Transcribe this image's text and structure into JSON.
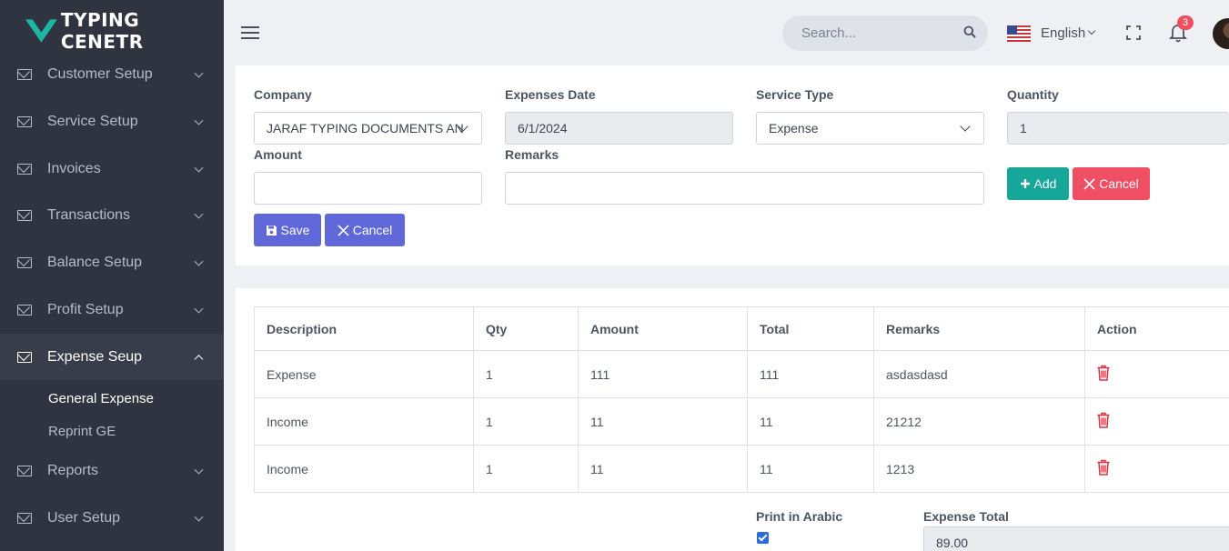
{
  "app": {
    "name": "TYPING CENETR"
  },
  "sidebar": {
    "items": [
      {
        "label": "Customer Setup"
      },
      {
        "label": "Service Setup"
      },
      {
        "label": "Invoices"
      },
      {
        "label": "Transactions"
      },
      {
        "label": "Balance Setup"
      },
      {
        "label": "Profit Setup"
      },
      {
        "label": "Expense Seup"
      },
      {
        "label": "Reports"
      },
      {
        "label": "User Setup"
      }
    ],
    "subitems": [
      {
        "label": "General Expense"
      },
      {
        "label": "Reprint GE"
      }
    ]
  },
  "topbar": {
    "search_placeholder": "Search...",
    "language": "English",
    "notification_count": "3",
    "icons": [
      "hamburger-icon",
      "search-icon",
      "us-flag-icon",
      "fullscreen-icon",
      "bell-icon",
      "avatar"
    ]
  },
  "form": {
    "company_label": "Company",
    "company_value": "JARAF TYPING DOCUMENTS AN",
    "date_label": "Expenses Date",
    "date_value": "6/1/2024",
    "service_type_label": "Service Type",
    "service_type_value": "Expense",
    "quantity_label": "Quantity",
    "quantity_value": "1",
    "amount_label": "Amount",
    "amount_value": "",
    "remarks_label": "Remarks",
    "remarks_value": "",
    "add_label": "Add",
    "cancel_small_label": "Cancel",
    "save_label": "Save",
    "cancel_label": "Cancel"
  },
  "table": {
    "headers": [
      "Description",
      "Qty",
      "Amount",
      "Total",
      "Remarks",
      "Action"
    ],
    "rows": [
      {
        "description": "Expense",
        "qty": "1",
        "amount": "111",
        "total": "111",
        "remarks": "asdasdasd"
      },
      {
        "description": "Income",
        "qty": "1",
        "amount": "11",
        "total": "11",
        "remarks": "21212"
      },
      {
        "description": "Income",
        "qty": "1",
        "amount": "11",
        "total": "11",
        "remarks": "1213"
      }
    ]
  },
  "footer": {
    "print_arabic_label": "Print in Arabic",
    "print_arabic_checked": true,
    "expense_total_label": "Expense Total",
    "expense_total_value": "89.00"
  },
  "colors": {
    "sidebar_bg": "#2f3440",
    "accent_teal": "#16a69a",
    "accent_red": "#f04e63",
    "accent_purple": "#6067d8",
    "trash_red": "#e03040"
  }
}
